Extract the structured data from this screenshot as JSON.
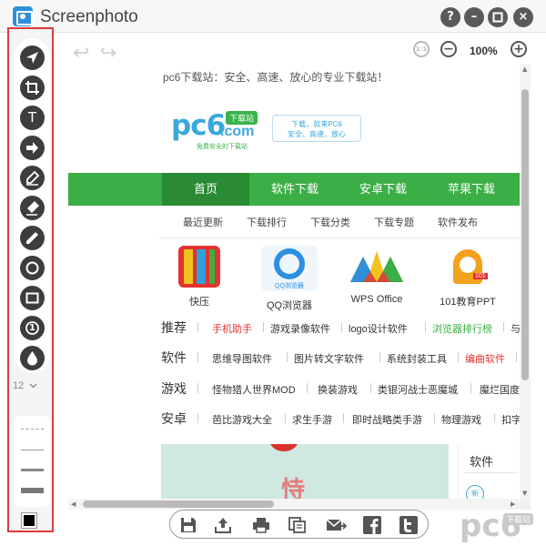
{
  "window": {
    "title": "Screenphoto"
  },
  "window_controls": {
    "help": "?",
    "minimize": "–",
    "maximize": "□",
    "close": "×"
  },
  "toolbar": {
    "tools": [
      {
        "name": "send-icon"
      },
      {
        "name": "crop-icon"
      },
      {
        "name": "text-icon",
        "glyph": "T"
      },
      {
        "name": "arrow-icon"
      },
      {
        "name": "highlighter-icon"
      },
      {
        "name": "marker-icon"
      },
      {
        "name": "pencil-icon"
      },
      {
        "name": "ellipse-icon"
      },
      {
        "name": "rectangle-icon"
      },
      {
        "name": "number-icon",
        "glyph": "1"
      },
      {
        "name": "blur-drop-icon"
      }
    ],
    "font_size": "12",
    "line_styles": [
      "dotted",
      "thin",
      "medium",
      "thick"
    ],
    "current_color": "#000000"
  },
  "topbar": {
    "zoom_level": "100%"
  },
  "webpage": {
    "slogan": "pc6下载站：安全、高速、放心的专业下载站！",
    "logo": {
      "main": "pc6",
      "com": ".com",
      "badge": "下载站",
      "tagline": "免费安全的下载站"
    },
    "slogan_box": [
      "下载，就来PC6",
      "安全、高速、放心"
    ],
    "nav": [
      "首页",
      "软件下载",
      "安卓下载",
      "苹果下载"
    ],
    "subnav": [
      "最近更新",
      "下载排行",
      "下载分类",
      "下载专题",
      "软件发布"
    ],
    "apps": [
      "快压",
      "QQ浏览器",
      "WPS Office",
      "101教育PPT"
    ],
    "app_badges": {
      "qq": "QQ浏览器",
      "ppt": "101"
    },
    "categories": [
      {
        "title": "推荐",
        "links": [
          "手机助手",
          "游戏录像软件",
          "logo设计软件",
          "浏览器排行榜",
          "与"
        ]
      },
      {
        "title": "软件",
        "links": [
          "思维导图软件",
          "图片转文字软件",
          "系统封装工具",
          "编曲软件",
          ""
        ]
      },
      {
        "title": "游戏",
        "links": [
          "怪物猎人世界MOD",
          "换装游戏",
          "类银河战士恶魔城",
          "魔烂国度"
        ]
      },
      {
        "title": "安卓",
        "links": [
          "芭比游戏大全",
          "求生手游",
          "即时战略类手游",
          "物理游戏",
          "扣字"
        ]
      }
    ],
    "side_panel": {
      "title": "软件",
      "badge": "新"
    },
    "banner_char": "恃"
  },
  "watermark": {
    "text": "pc6",
    "badge": "下载站"
  },
  "colors": {
    "accent_red": "#dd3b3b",
    "nav_green": "#3cae46",
    "brand_blue": "#3aa8dc"
  }
}
